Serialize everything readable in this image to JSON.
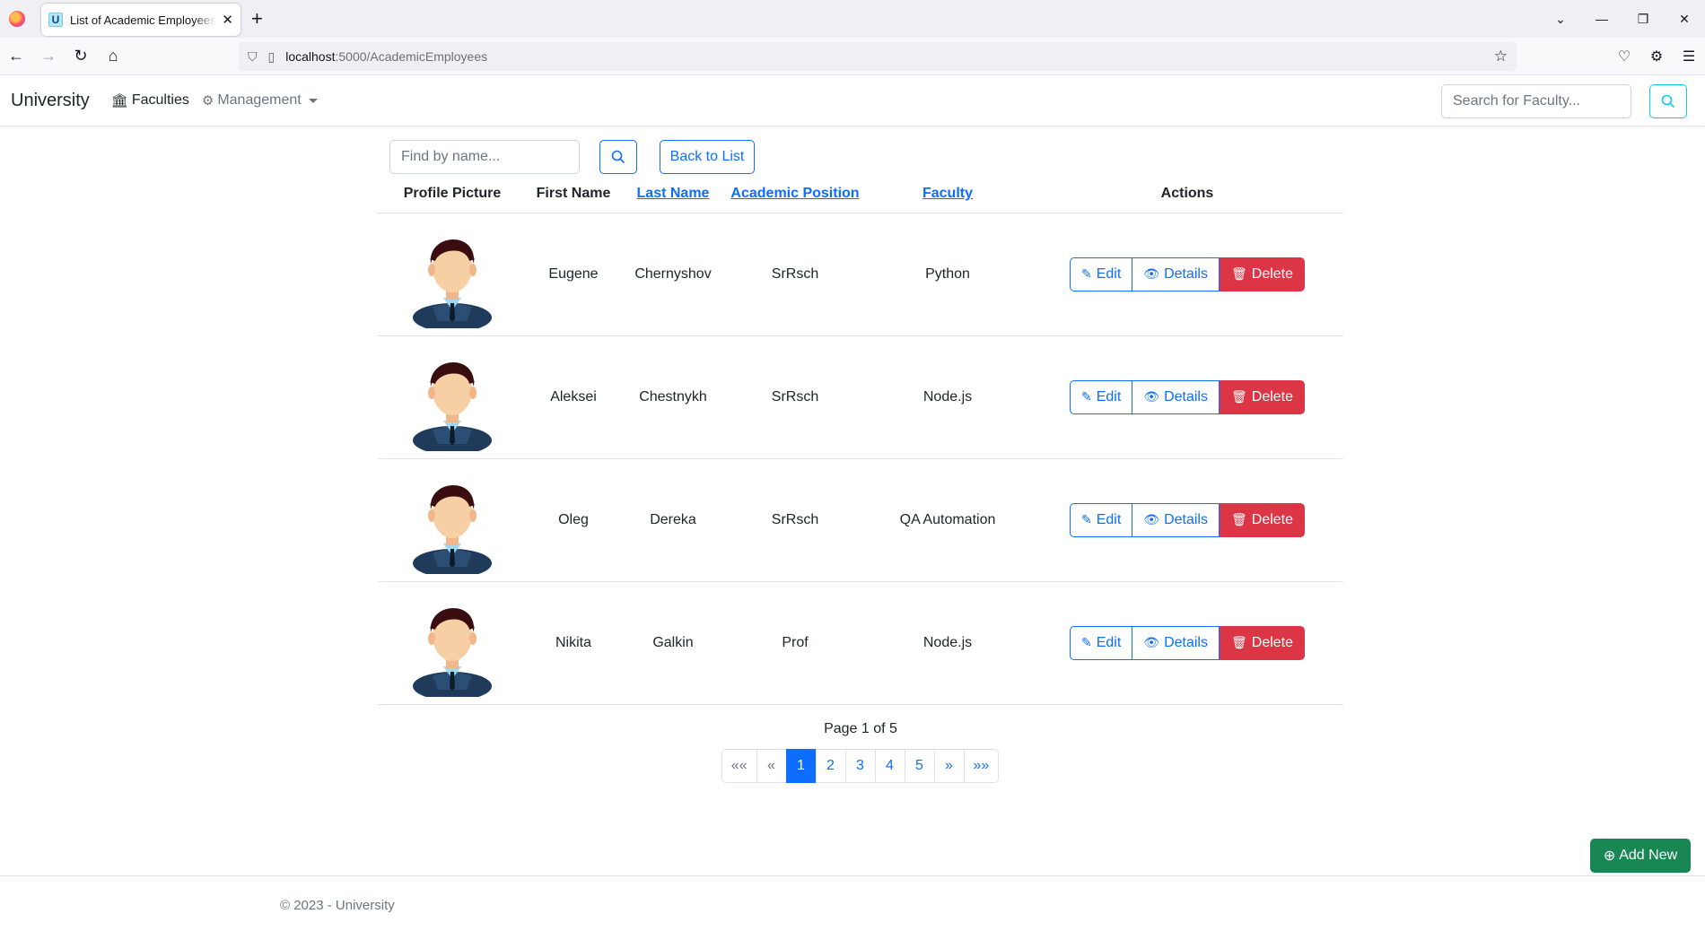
{
  "browser": {
    "tab_title": "List of Academic Employees - University",
    "tab_favicon": "U",
    "url_host": "localhost",
    "url_path": ":5000/AcademicEmployees"
  },
  "nav": {
    "brand": "University",
    "faculties": "Faculties",
    "management": "Management",
    "search_placeholder": "Search for Faculty..."
  },
  "toolbar": {
    "find_placeholder": "Find by name...",
    "back_label": "Back to List"
  },
  "table": {
    "headers": {
      "profile_picture": "Profile Picture",
      "first_name": "First Name",
      "last_name": "Last Name",
      "academic_position": "Academic Position",
      "faculty": "Faculty",
      "actions": "Actions"
    },
    "rows": [
      {
        "first_name": "Eugene",
        "last_name": "Chernyshov",
        "position": "SrRsch",
        "faculty": "Python"
      },
      {
        "first_name": "Aleksei",
        "last_name": "Chestnykh",
        "position": "SrRsch",
        "faculty": "Node.js"
      },
      {
        "first_name": "Oleg",
        "last_name": "Dereka",
        "position": "SrRsch",
        "faculty": "QA Automation"
      },
      {
        "first_name": "Nikita",
        "last_name": "Galkin",
        "position": "Prof",
        "faculty": "Node.js"
      }
    ],
    "actions": {
      "edit": "Edit",
      "details": "Details",
      "delete": "Delete"
    }
  },
  "pagination": {
    "info": "Page 1 of 5",
    "first": "««",
    "prev": "«",
    "pages": [
      "1",
      "2",
      "3",
      "4",
      "5"
    ],
    "next": "»",
    "last": "»»",
    "current": "1"
  },
  "add_new": "Add New",
  "footer": "© 2023 - University",
  "colors": {
    "primary": "#0d6efd",
    "danger": "#dc3545",
    "success": "#198754",
    "info": "#0dcaf0"
  }
}
